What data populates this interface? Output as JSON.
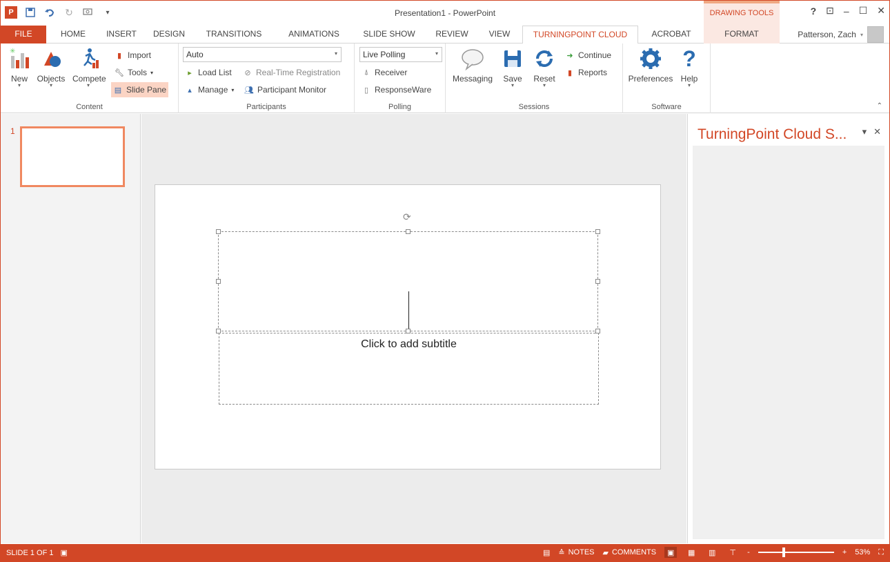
{
  "window": {
    "title": "Presentation1 - PowerPoint"
  },
  "qat": {
    "app_icon": "P",
    "save_icon": "save-icon",
    "undo_icon": "undo-icon",
    "redo_icon": "redo-icon",
    "present_icon": "start-from-beginning-icon"
  },
  "contextual": {
    "drawing_tools": "DRAWING TOOLS"
  },
  "window_controls": {
    "help": "?",
    "ribbon_options": "⊡",
    "minimize": "–",
    "restore": "☐",
    "close": "✕"
  },
  "tabs": [
    {
      "label": "FILE"
    },
    {
      "label": "HOME"
    },
    {
      "label": "INSERT"
    },
    {
      "label": "DESIGN"
    },
    {
      "label": "TRANSITIONS"
    },
    {
      "label": "ANIMATIONS"
    },
    {
      "label": "SLIDE SHOW"
    },
    {
      "label": "REVIEW"
    },
    {
      "label": "VIEW"
    },
    {
      "label": "TURNINGPOINT CLOUD"
    },
    {
      "label": "ACROBAT"
    },
    {
      "label": "FORMAT"
    }
  ],
  "user": {
    "name": "Patterson, Zach"
  },
  "ribbon": {
    "content": {
      "label": "Content",
      "new": "New",
      "objects": "Objects",
      "compete": "Compete",
      "import": "Import",
      "tools": "Tools",
      "slide_pane": "Slide Pane"
    },
    "participants": {
      "label": "Participants",
      "list_value": "Auto",
      "load_list": "Load List",
      "realtime_registration": "Real-Time Registration",
      "manage": "Manage",
      "participant_monitor": "Participant Monitor"
    },
    "polling": {
      "label": "Polling",
      "mode_value": "Live Polling",
      "receiver": "Receiver",
      "responseware": "ResponseWare"
    },
    "sessions": {
      "label": "Sessions",
      "messaging": "Messaging",
      "save": "Save",
      "reset": "Reset",
      "continue": "Continue",
      "reports": "Reports"
    },
    "software": {
      "label": "Software",
      "preferences": "Preferences",
      "help": "Help"
    }
  },
  "thumbnails": [
    {
      "number": "1"
    }
  ],
  "slide": {
    "subtitle_placeholder": "Click to add subtitle"
  },
  "taskpane": {
    "title": "TurningPoint Cloud S...",
    "menu": "▾",
    "close": "✕"
  },
  "statusbar": {
    "slide_info": "SLIDE 1 OF 1",
    "notes": "NOTES",
    "comments": "COMMENTS",
    "zoom": "53%",
    "zoom_minus": "-",
    "zoom_plus": "+"
  },
  "colors": {
    "accent": "#d24726",
    "accent_light": "#fbe8e2"
  }
}
